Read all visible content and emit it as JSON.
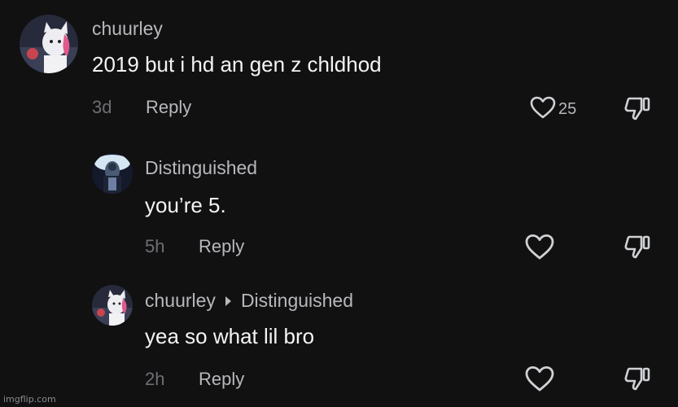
{
  "colors": {
    "background": "#111112",
    "username": "#b7b8bc",
    "body_text": "#f4f4f5",
    "timestamp": "#6e6f74"
  },
  "comments": [
    {
      "username": "chuurley",
      "text": "2019 but i hd an gen z chldhod",
      "time": "3d",
      "reply_label": "Reply",
      "like_count": "25",
      "avatar": "cat-character-avatar"
    },
    {
      "username": "Distinguished",
      "text": "you’re 5.",
      "time": "5h",
      "reply_label": "Reply",
      "avatar": "dark-figure-avatar"
    },
    {
      "username": "chuurley",
      "reply_to": "Distinguished",
      "text": "yea so what lil bro",
      "time": "2h",
      "reply_label": "Reply",
      "avatar": "cat-character-avatar"
    }
  ],
  "icons": {
    "like": "heart-icon",
    "dislike": "thumbs-down-icon",
    "reply_indicator": "triangle-right-icon"
  },
  "watermark": "imgflip.com"
}
